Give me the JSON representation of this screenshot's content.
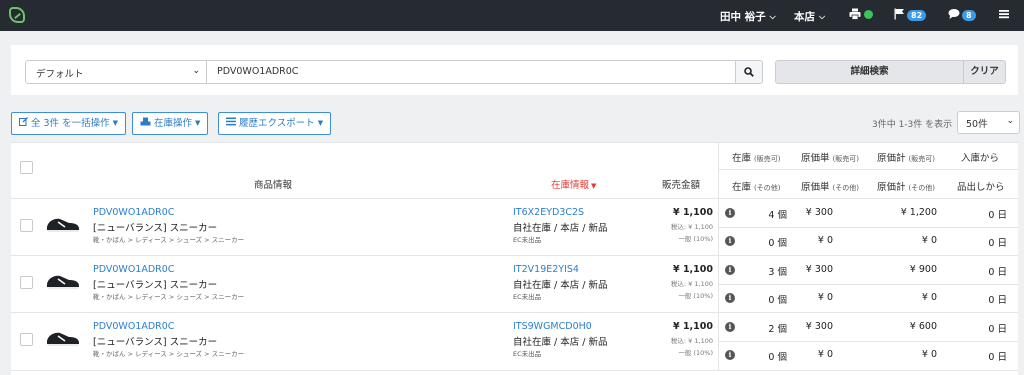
{
  "topbar": {
    "user_name": "田中 裕子",
    "store": "本店",
    "flag_count": "82",
    "chat_count": "8",
    "icons": {
      "logo": "leaf-logo",
      "printer": "printer-icon",
      "flag": "flag-icon",
      "chat": "chat-icon",
      "menu": "hamburger-icon"
    },
    "status_color": "#3cc35a"
  },
  "search": {
    "preset": "デフォルト",
    "query": "PDV0WO1ADR0C",
    "advanced_label": "詳細検索",
    "clear_label": "クリア"
  },
  "actions": {
    "bulk_label": "全 3件 を一括操作",
    "stock_label": "在庫操作",
    "export_label": "履歴エクスポート",
    "result_count": "3件中 1-3件 を表示",
    "per_page": "50件"
  },
  "table": {
    "headers": {
      "product": "商品情報",
      "stock_info": "在庫情報",
      "sale_price": "販売金額",
      "stock": "在庫",
      "stock_sub1": "(販売可)",
      "stock_sub2": "(その他)",
      "unit_cost": "原価単",
      "unit_cost_sub1": "(販売可)",
      "unit_cost_sub2": "(その他)",
      "total_cost": "原価計",
      "total_cost_sub1": "(販売可)",
      "total_cost_sub2": "(その他)",
      "days_top": "入庫から",
      "days_bottom": "品出しから"
    },
    "rows": [
      {
        "product_code": "PDV0WO1ADR0C",
        "product_name": "[ニューバランス] スニーカー",
        "category": "靴・かばん > レディース > シューズ > スニーカー",
        "stock_code": "IT6X2EYD3C2S",
        "location": "自社在庫 / 本店 / 新品",
        "ec_status": "EC未出品",
        "price": "¥ 1,100",
        "price_tax": "税込: ¥ 1,100",
        "price_type": "一般 (10%)",
        "stock_sellable": "4 個",
        "stock_other": "0 個",
        "unit_cost_sellable": "¥ 300",
        "unit_cost_other": "¥ 0",
        "total_cost_sellable": "¥ 1,200",
        "total_cost_other": "¥ 0",
        "days_in": "0 日",
        "days_out": "0 日"
      },
      {
        "product_code": "PDV0WO1ADR0C",
        "product_name": "[ニューバランス] スニーカー",
        "category": "靴・かばん > レディース > シューズ > スニーカー",
        "stock_code": "IT2V19E2YIS4",
        "location": "自社在庫 / 本店 / 新品",
        "ec_status": "EC未出品",
        "price": "¥ 1,100",
        "price_tax": "税込: ¥ 1,100",
        "price_type": "一般 (10%)",
        "stock_sellable": "3 個",
        "stock_other": "0 個",
        "unit_cost_sellable": "¥ 300",
        "unit_cost_other": "¥ 0",
        "total_cost_sellable": "¥ 900",
        "total_cost_other": "¥ 0",
        "days_in": "0 日",
        "days_out": "0 日"
      },
      {
        "product_code": "PDV0WO1ADR0C",
        "product_name": "[ニューバランス] スニーカー",
        "category": "靴・かばん > レディース > シューズ > スニーカー",
        "stock_code": "ITS9WGMCD0H0",
        "location": "自社在庫 / 本店 / 新品",
        "ec_status": "EC未出品",
        "price": "¥ 1,100",
        "price_tax": "税込: ¥ 1,100",
        "price_type": "一般 (10%)",
        "stock_sellable": "2 個",
        "stock_other": "0 個",
        "unit_cost_sellable": "¥ 300",
        "unit_cost_other": "¥ 0",
        "total_cost_sellable": "¥ 600",
        "total_cost_other": "¥ 0",
        "days_in": "0 日",
        "days_out": "0 日"
      }
    ]
  }
}
